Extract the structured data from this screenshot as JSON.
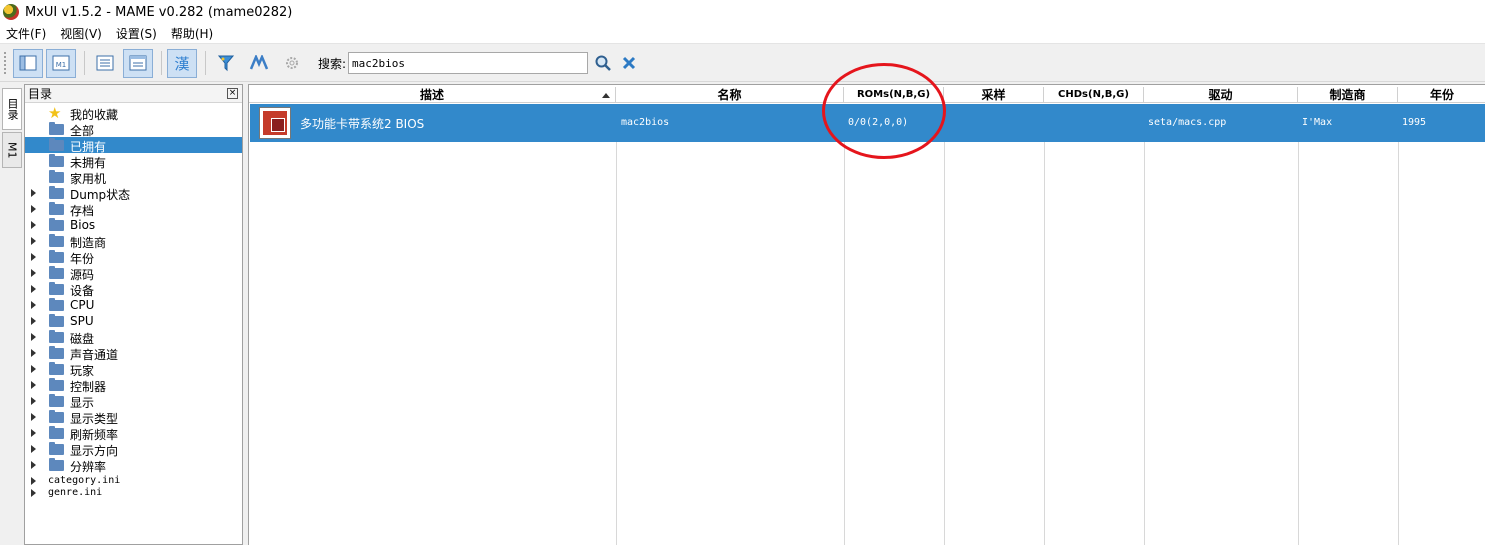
{
  "window": {
    "title": "MxUI v1.5.2 - MAME v0.282 (mame0282)"
  },
  "menu": [
    "文件(F)",
    "视图(V)",
    "设置(S)",
    "帮助(H)"
  ],
  "toolbar": {
    "search_label": "搜索:",
    "search_value": "mac2bios"
  },
  "sidetabs": [
    "目录",
    "M1"
  ],
  "tree": {
    "title": "目录",
    "items": [
      {
        "label": "我的收藏",
        "kind": "star",
        "expand": false
      },
      {
        "label": "全部",
        "kind": "folder",
        "expand": false
      },
      {
        "label": "已拥有",
        "kind": "folder",
        "expand": false,
        "selected": true
      },
      {
        "label": "未拥有",
        "kind": "folder",
        "expand": false
      },
      {
        "label": "家用机",
        "kind": "folder",
        "expand": false
      },
      {
        "label": "Dump状态",
        "kind": "folder",
        "expand": true
      },
      {
        "label": "存档",
        "kind": "folder",
        "expand": true
      },
      {
        "label": "Bios",
        "kind": "folder",
        "expand": true
      },
      {
        "label": "制造商",
        "kind": "folder",
        "expand": true
      },
      {
        "label": "年份",
        "kind": "folder",
        "expand": true
      },
      {
        "label": "源码",
        "kind": "folder",
        "expand": true
      },
      {
        "label": "设备",
        "kind": "folder",
        "expand": true
      },
      {
        "label": "CPU",
        "kind": "folder",
        "expand": true
      },
      {
        "label": "SPU",
        "kind": "folder",
        "expand": true
      },
      {
        "label": "磁盘",
        "kind": "folder",
        "expand": true
      },
      {
        "label": "声音通道",
        "kind": "folder",
        "expand": true
      },
      {
        "label": "玩家",
        "kind": "folder",
        "expand": true
      },
      {
        "label": "控制器",
        "kind": "folder",
        "expand": true
      },
      {
        "label": "显示",
        "kind": "folder",
        "expand": true
      },
      {
        "label": "显示类型",
        "kind": "folder",
        "expand": true
      },
      {
        "label": "刷新频率",
        "kind": "folder",
        "expand": true
      },
      {
        "label": "显示方向",
        "kind": "folder",
        "expand": true
      },
      {
        "label": "分辨率",
        "kind": "folder",
        "expand": true
      },
      {
        "label": "category.ini",
        "kind": "file",
        "expand": true
      },
      {
        "label": "genre.ini",
        "kind": "file",
        "expand": true
      }
    ]
  },
  "columns": [
    "描述",
    "名称",
    "ROMs(N,B,G)",
    "采样",
    "CHDs(N,B,G)",
    "驱动",
    "制造商",
    "年份"
  ],
  "rows": [
    {
      "description": "多功能卡带系统2 BIOS",
      "name": "mac2bios",
      "roms": "0/0(2,0,0)",
      "samples": "",
      "chds": "",
      "driver": "seta/macs.cpp",
      "manufacturer": "I'Max",
      "year": "1995"
    }
  ],
  "colors": {
    "selection": "#3289cb",
    "annotation": "#e5151c"
  }
}
